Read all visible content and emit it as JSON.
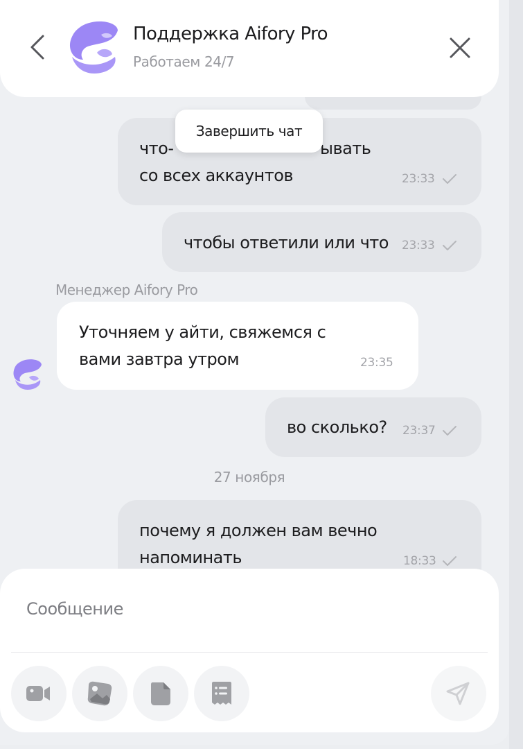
{
  "header": {
    "title": "Поддержка Aifory Pro",
    "subtitle": "Работаем 24/7",
    "back_icon": "chevron-left-icon",
    "close_icon": "close-icon",
    "logo_icon": "aifory-logo-icon"
  },
  "tooltip": {
    "label": "Завершить чат"
  },
  "messages": [
    {
      "text_line1": "что-",
      "text_line1_end": "ывать",
      "text_line2": "со всех аккаунтов",
      "time": "23:33",
      "read": true
    },
    {
      "text": "чтобы ответили или что",
      "time": "23:33",
      "read": true
    },
    {
      "sender": "Менеджер Aifory Pro",
      "text_line1": "Уточняем у айти, свяжемся с",
      "text_line2": "вами завтра утром",
      "time": "23:35"
    },
    {
      "text": "во сколько?",
      "time": "23:37",
      "read": true
    },
    {
      "text_line1": "почему я должен вам вечно",
      "text_line2": "напоминать",
      "time": "18:33",
      "read": true
    }
  ],
  "date_separator": "27 ноября",
  "composer": {
    "placeholder": "Сообщение",
    "tools": [
      "video-icon",
      "image-icon",
      "file-icon",
      "receipt-icon"
    ],
    "send_icon": "send-icon"
  },
  "colors": {
    "accent_logo": "#9c87f5",
    "outgoing_bubble": "#e3e5e9",
    "incoming_bubble": "#ffffff",
    "background": "#eef0f3",
    "muted_text": "#9a9ba0"
  }
}
